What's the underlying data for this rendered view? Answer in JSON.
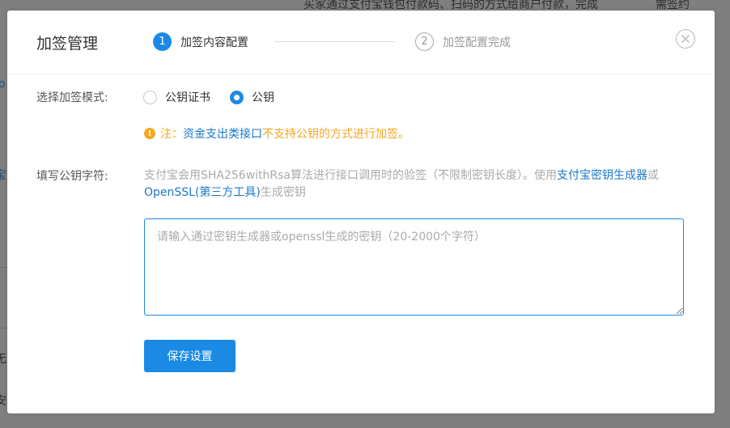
{
  "background": {
    "top_text": "买家通过支付宝钱包付款码、扫码的方式给商户付款，完成",
    "top_right_text": "需签约",
    "left_fragments": [
      "o",
      "宝",
      "无",
      "安"
    ]
  },
  "modal": {
    "title": "加签管理",
    "steps": [
      {
        "num": "1",
        "label": "加签内容配置",
        "state": "active"
      },
      {
        "num": "2",
        "label": "加签配置完成",
        "state": "inactive"
      }
    ],
    "mode": {
      "label": "选择加签模式:",
      "options": [
        {
          "label": "公钥证书",
          "checked": false
        },
        {
          "label": "公钥",
          "checked": true
        }
      ]
    },
    "notice": {
      "icon": "!",
      "prefix": "注：",
      "link": "资金支出类接口",
      "suffix": "不支持公钥的方式进行加签。"
    },
    "key": {
      "label": "填写公钥字符:",
      "desc_part1": "支付宝会用SHA256withRsa算法进行接口调用时的验签（不限制密钥长度）。使用",
      "desc_link1": "支付宝密钥生成器",
      "desc_part2": "或",
      "desc_link2": "OpenSSL(第三方工具)",
      "desc_part3": "生成密钥",
      "placeholder": "请输入通过密钥生成器或openssl生成的密钥（20-2000个字符）",
      "value": ""
    },
    "save_label": "保存设置"
  },
  "colors": {
    "accent": "#1a8ae5",
    "warning": "#f5a623",
    "link": "#1a78c8",
    "overlay": "#7f7f7f"
  }
}
